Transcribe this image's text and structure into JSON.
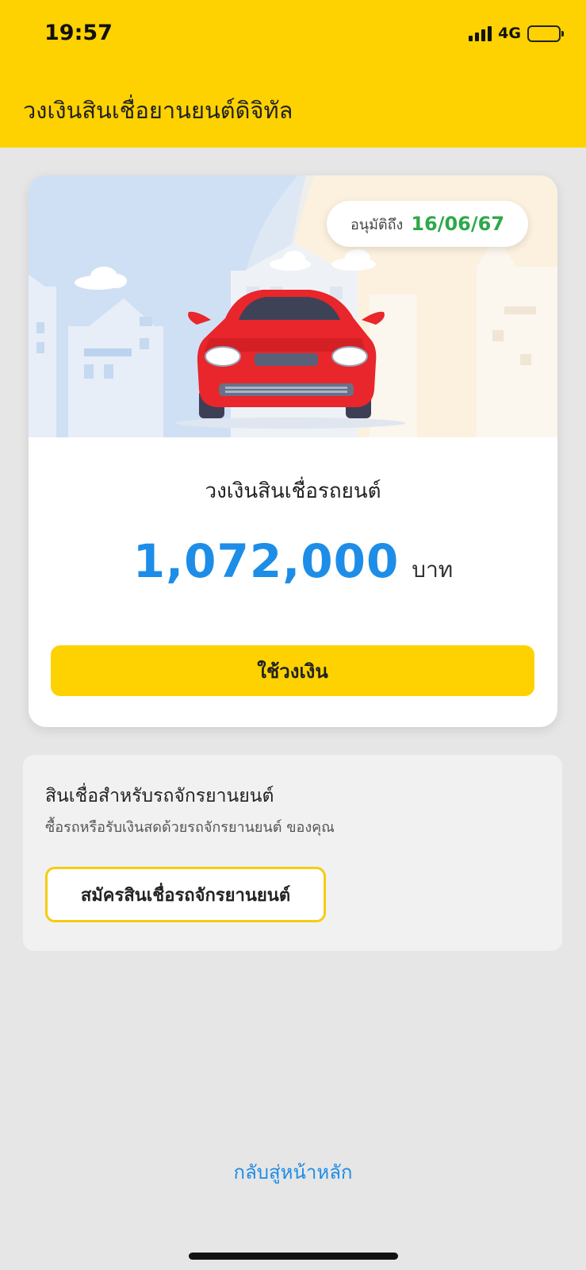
{
  "status_bar": {
    "time": "19:57",
    "network": "4G"
  },
  "header": {
    "title": "วงเงินสินเชื่อยานยนต์ดิจิทัล"
  },
  "card": {
    "approval_label": "อนุมัติถึง",
    "approval_date": "16/06/67",
    "limit_label": "วงเงินสินเชื่อรถยนต์",
    "amount": "1,072,000",
    "currency": "บาท",
    "use_button": "ใช้วงเงิน"
  },
  "motorcycle": {
    "title": "สินเชื่อสำหรับรถจักรยานยนต์",
    "subtitle": "ซื้อรถหรือรับเงินสดด้วยรถจักรยานยนต์ ของคุณ",
    "apply_button": "สมัครสินเชื่อรถจักรยานยนต์"
  },
  "footer": {
    "home_link": "กลับสู่หน้าหลัก"
  },
  "colors": {
    "brand_yellow": "#fdd200",
    "amount_blue": "#1d8de8",
    "date_green": "#2fa84a",
    "car_red": "#e8262b"
  }
}
